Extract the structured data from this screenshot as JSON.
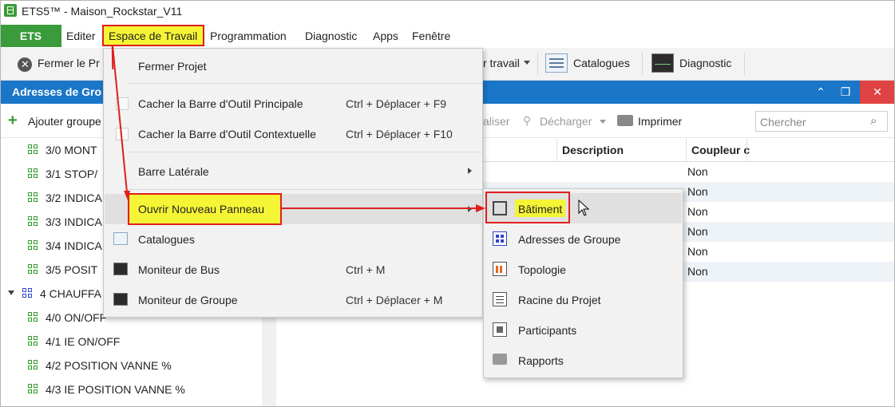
{
  "window": {
    "title": "ETS5™ - Maison_Rockstar_V11"
  },
  "menubar": {
    "ets_label": "ETS",
    "items": [
      "Editer",
      "Espace de Travail",
      "Programmation",
      "Diagnostic",
      "Apps",
      "Fenêtre"
    ]
  },
  "toolbar": {
    "close_project": "Fermer le Pr",
    "workspace": "r travail",
    "catalogs": "Catalogues",
    "diagnostic": "Diagnostic"
  },
  "panel": {
    "title": "Adresses de Gro",
    "add_group": "Ajouter groupe",
    "realiser": "aliser",
    "decharger": "Décharger",
    "imprimer": "Imprimer",
    "search_placeholder": "Chercher"
  },
  "tree": {
    "items": [
      "3/0 MONT",
      "3/1 STOP/",
      "3/2 INDICA",
      "3/3 INDICA",
      "3/4 INDICA",
      "3/5 POSIT"
    ],
    "group": "4 CHAUFFA",
    "subitems": [
      "4/0 ON/OFF",
      "4/1 IE ON/OFF",
      "4/2 POSITION VANNE %",
      "4/3 IE POSITION VANNE %"
    ]
  },
  "table": {
    "headers": [
      "Description",
      "Coupleur c"
    ],
    "coupleur_values": [
      "Non",
      "Non",
      "Non",
      "Non",
      "Non",
      "Non"
    ]
  },
  "dropdown": {
    "items": [
      {
        "label": "Fermer Projet",
        "shortcut": ""
      },
      {
        "label": "Cacher la Barre d'Outil Principale",
        "shortcut": "Ctrl + Déplacer + F9"
      },
      {
        "label": "Cacher la Barre d'Outil Contextuelle",
        "shortcut": "Ctrl + Déplacer + F10"
      },
      {
        "label": "Barre Latérale",
        "shortcut": ""
      },
      {
        "label": "Ouvrir Nouveau Panneau",
        "shortcut": ""
      },
      {
        "label": "Catalogues",
        "shortcut": ""
      },
      {
        "label": "Moniteur de Bus",
        "shortcut": "Ctrl + M"
      },
      {
        "label": "Moniteur de Groupe",
        "shortcut": "Ctrl + Déplacer + M"
      }
    ]
  },
  "submenu": {
    "items": [
      "Bâtiment",
      "Adresses de Groupe",
      "Topologie",
      "Racine du Projet",
      "Participants",
      "Rapports"
    ]
  },
  "colors": {
    "accent_green": "#3a9b3a",
    "panel_blue": "#1976c8",
    "highlight_yellow": "#f5f535",
    "annotation_red": "#e01e1e"
  }
}
